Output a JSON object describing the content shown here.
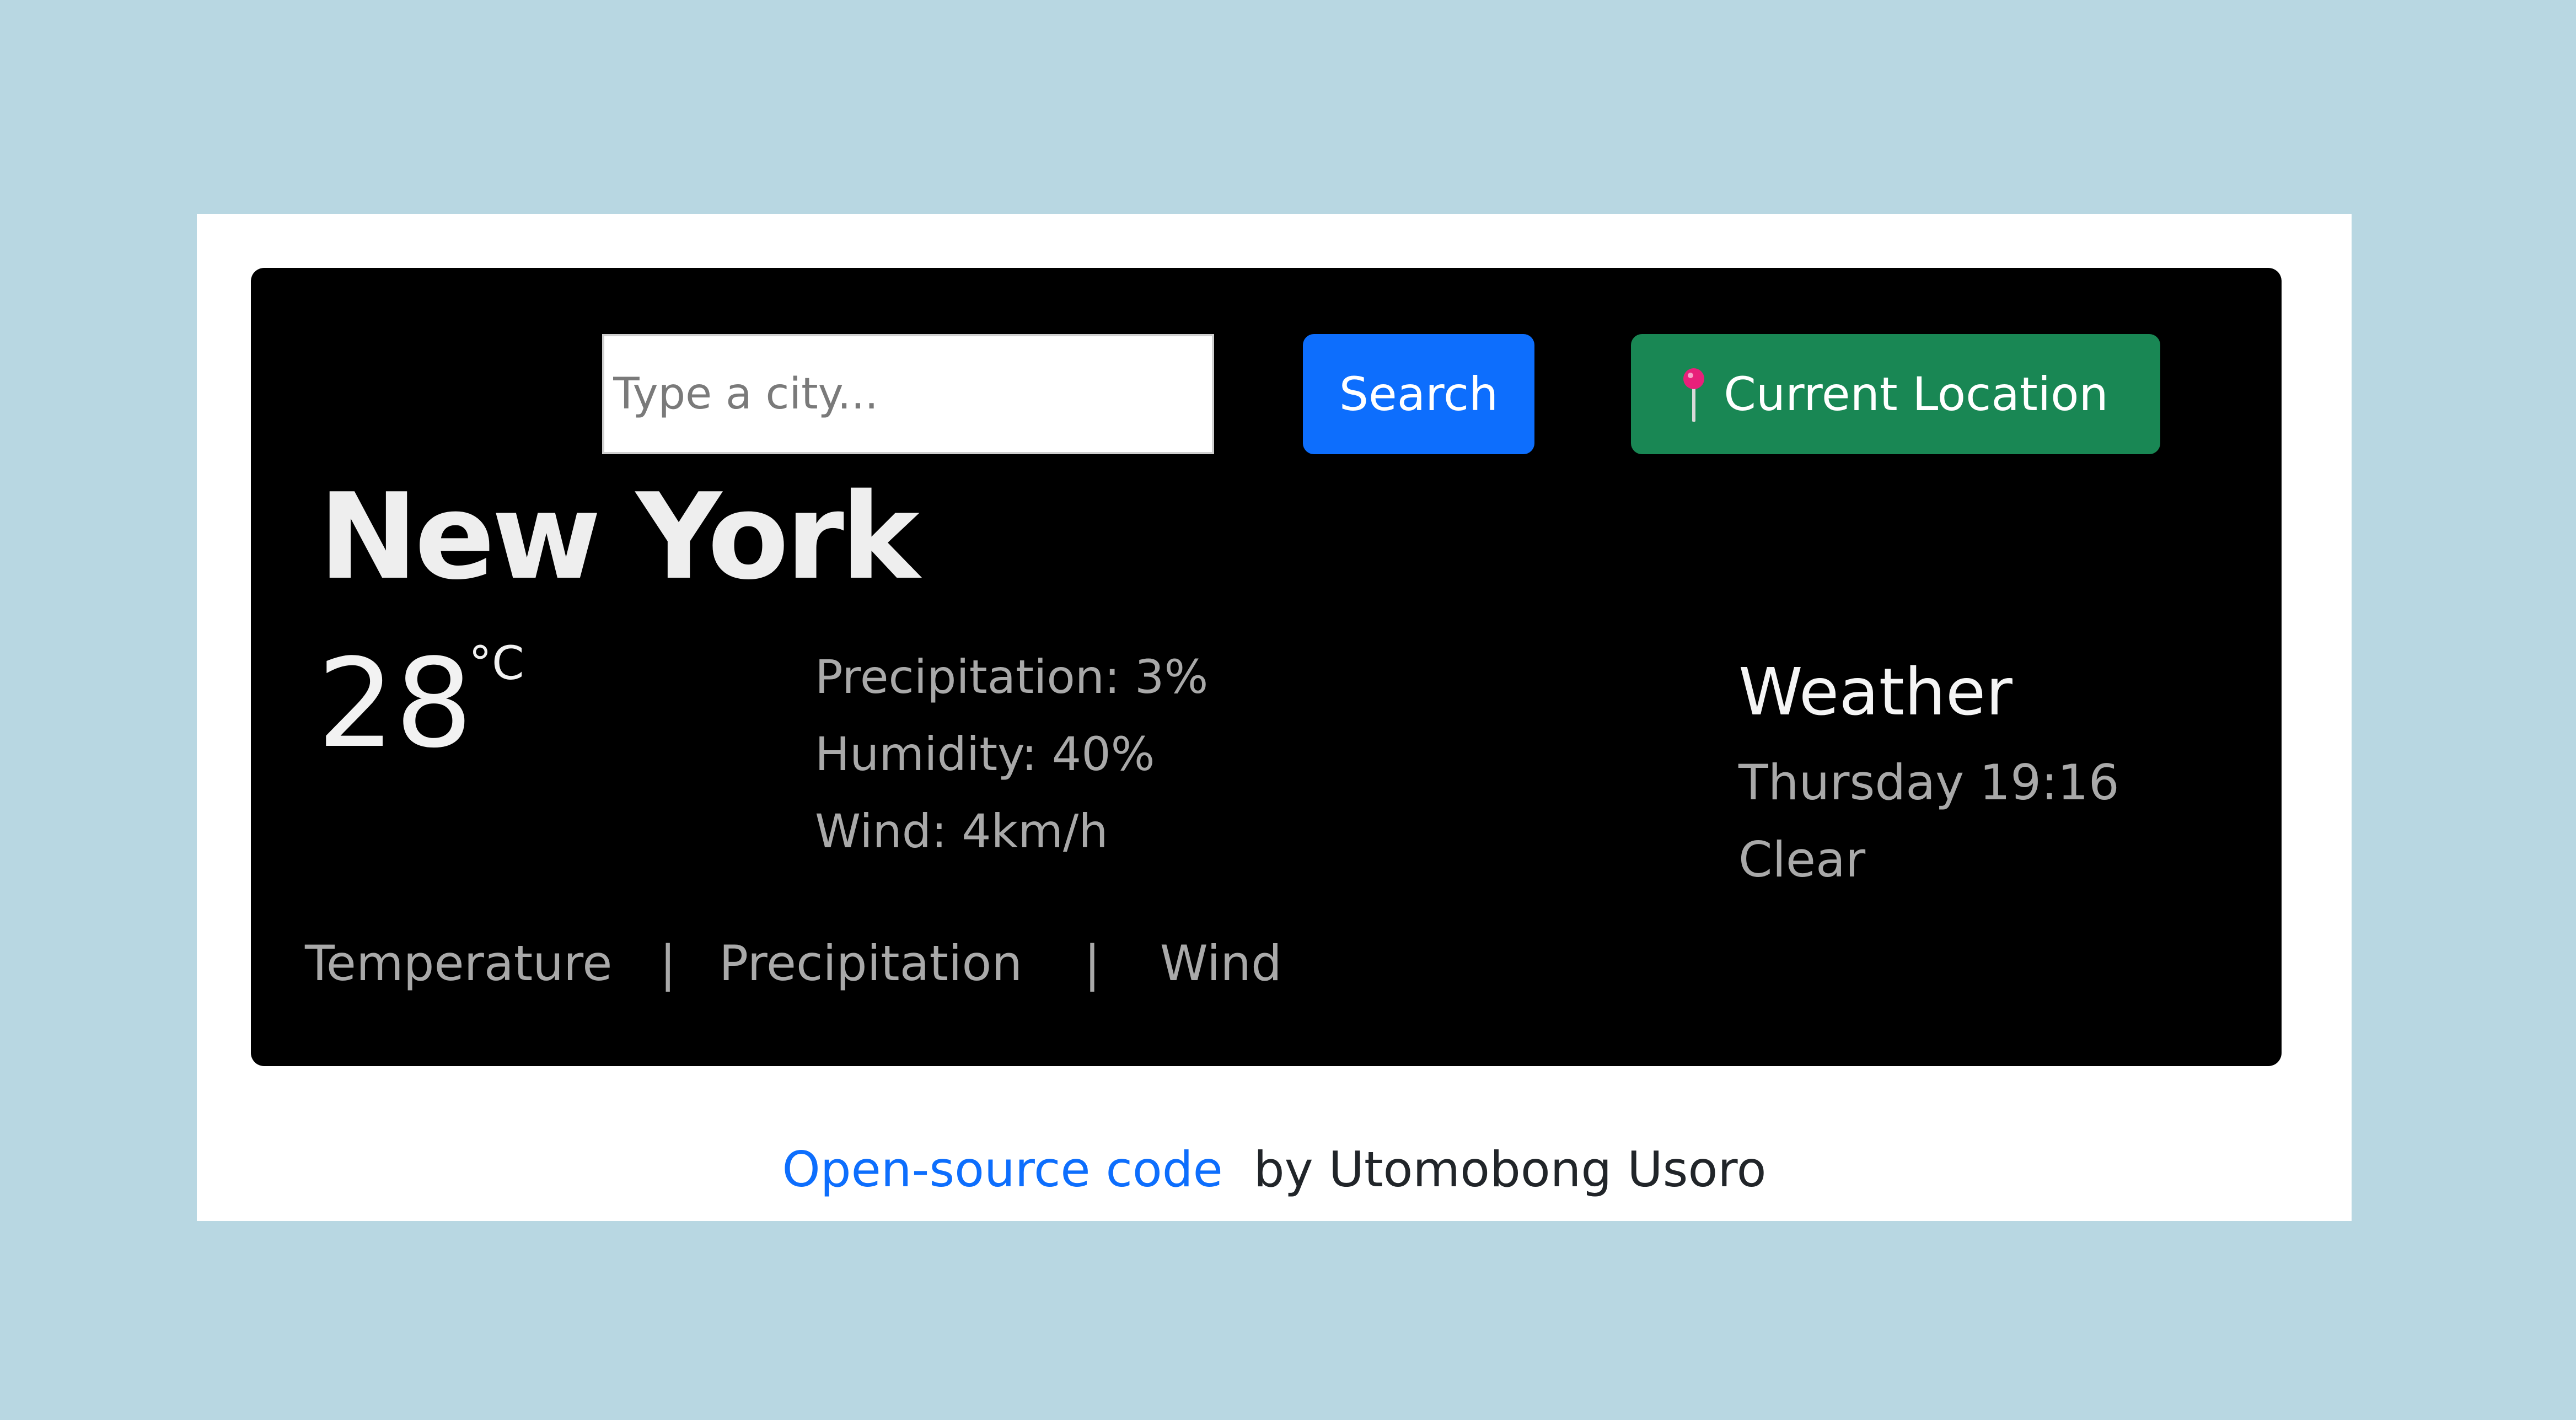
{
  "search": {
    "placeholder": "Type a city...",
    "value": "",
    "button_label": "Search"
  },
  "location_button": {
    "label": "Current Location",
    "icon": "pushpin-icon",
    "icon_color": "#e8207a"
  },
  "current": {
    "city": "New York",
    "temperature": "28",
    "unit": "°C",
    "precipitation": "Precipitation: 3%",
    "humidity": "Humidity: 40%",
    "wind": "Wind: 4km/h"
  },
  "weather": {
    "title": "Weather",
    "datetime": "Thursday 19:16",
    "condition": "Clear"
  },
  "tabs": [
    {
      "label": "Temperature"
    },
    {
      "label": "Precipitation"
    },
    {
      "label": "Wind"
    }
  ],
  "tab_separator": "|",
  "footer": {
    "link_text": "Open-source code",
    "suffix": "by Utomobong Usoro"
  },
  "colors": {
    "page_bg": "#b8d7e2",
    "card_bg": "#000000",
    "search_button": "#0d6efd",
    "location_button": "#198754",
    "link": "#0d6efd"
  }
}
